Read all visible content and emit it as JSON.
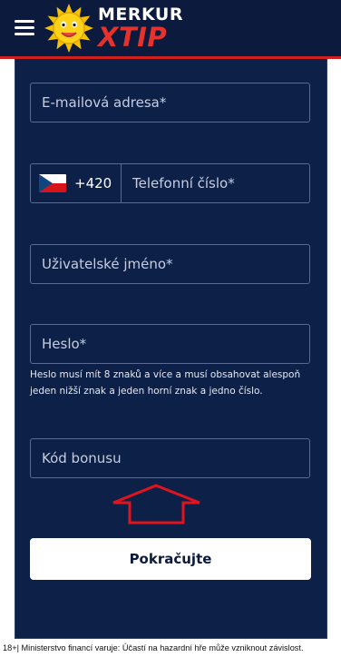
{
  "header": {
    "brand_top": "MERKUR",
    "brand_bottom": "XTIP"
  },
  "form": {
    "email_placeholder": "E-mailová adresa*",
    "phone_prefix": "+420",
    "phone_placeholder": "Telefonní číslo*",
    "username_placeholder": "Uživatelské jméno*",
    "password_placeholder": "Heslo*",
    "password_hint": "Heslo musí mít 8 znaků a více a musí obsahovat alespoň jeden nižší znak a jeden horní znak a jedno číslo.",
    "bonus_placeholder": "Kód bonusu",
    "continue_label": "Pokračujte"
  },
  "footer": {
    "warning": "18+| Ministerstvo financí varuje: Účastí na hazardní hře může vzniknout závislost."
  },
  "colors": {
    "header_bg": "#0b1a3d",
    "panel_bg": "#0d2048",
    "accent_red": "#e5322d",
    "field_border": "#5a6a94"
  },
  "icons": {
    "menu": "hamburger-menu-icon",
    "logo": "sun-logo-icon",
    "flag": "czech-flag-icon",
    "arrow": "red-up-arrow-icon"
  }
}
